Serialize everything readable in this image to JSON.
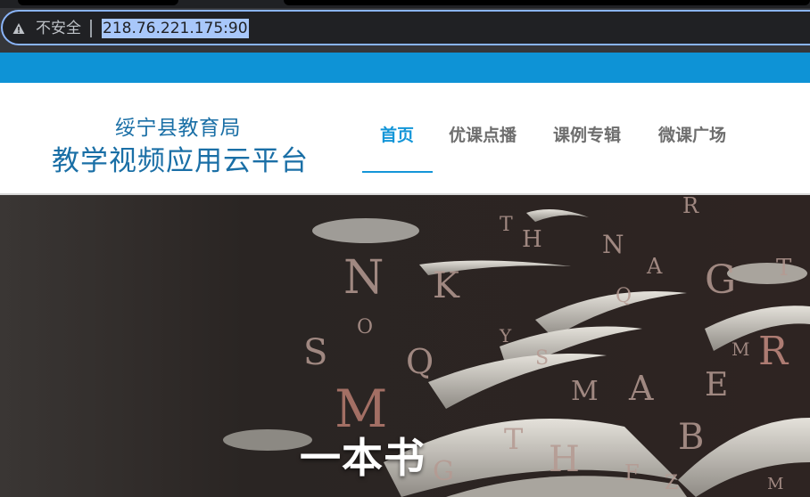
{
  "browser": {
    "security_label": "不安全",
    "url": "218.76.221.175:90",
    "warning_icon": "warning-triangle-icon",
    "address_border_color": "#8ab4f8"
  },
  "site": {
    "logo_line1": "绥宁县教育局",
    "logo_line2": "教学视频应用云平台",
    "brand_color": "#1a6fa6",
    "top_bar_color": "#0e93d6",
    "nav": [
      {
        "label": "首页",
        "active": true
      },
      {
        "label": "优课点播",
        "active": false
      },
      {
        "label": "课例专辑",
        "active": false
      },
      {
        "label": "微课广场",
        "active": false
      }
    ],
    "nav_active_color": "#1496d8"
  },
  "banner": {
    "caption": "一本书",
    "letters": "THNAQGRKSOYMAERMAEBGHFZ"
  }
}
